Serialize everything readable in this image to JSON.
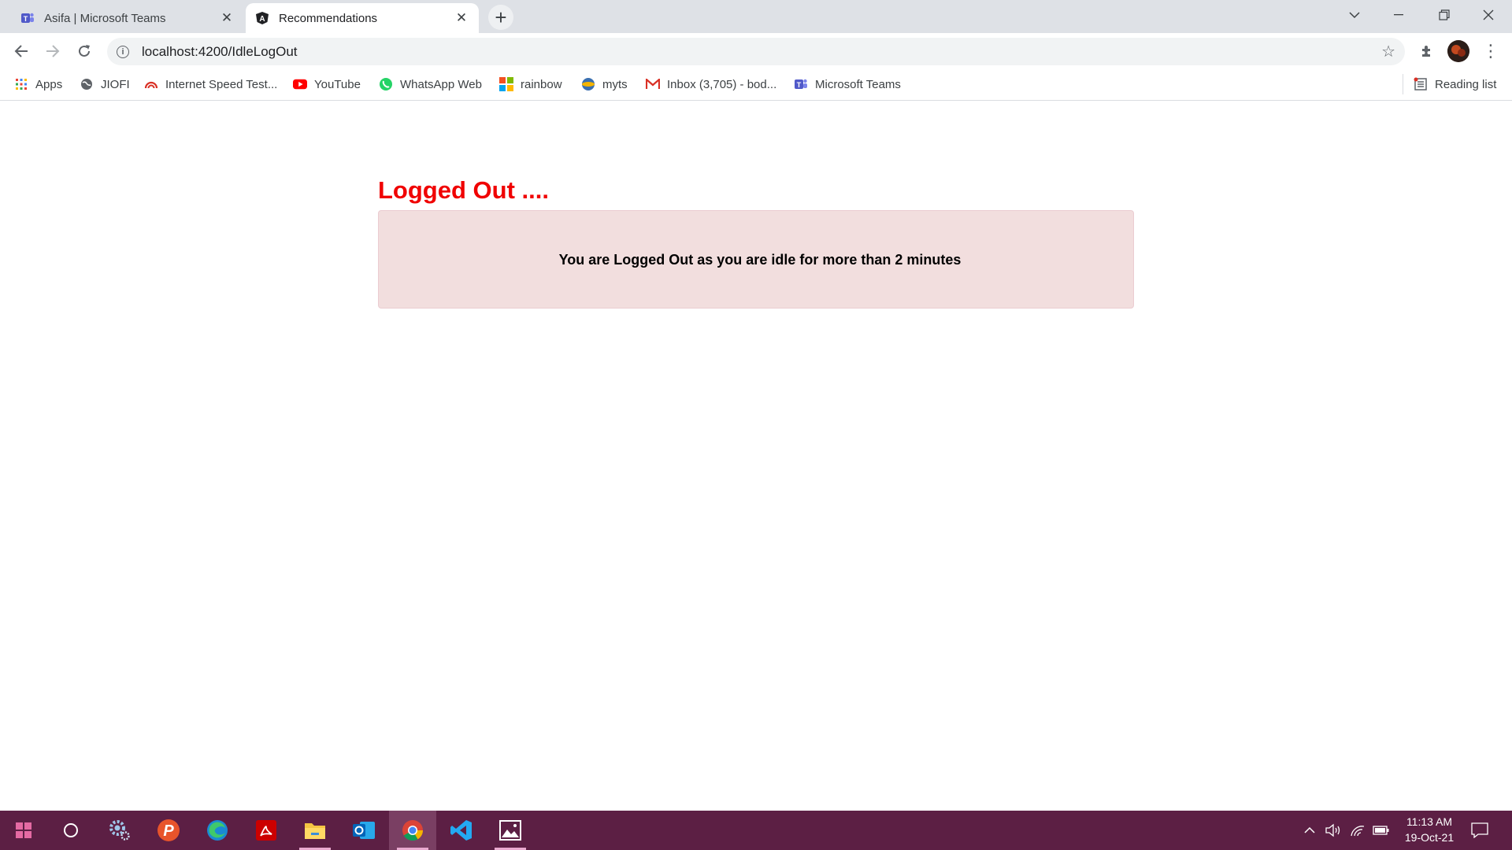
{
  "browser": {
    "tabs": [
      {
        "label": "Asifa | Microsoft Teams",
        "icon": "teams-icon",
        "active": false
      },
      {
        "label": "Recommendations",
        "icon": "angular-icon",
        "active": true
      }
    ],
    "address": "localhost:4200/IdleLogOut"
  },
  "bookmarks": [
    {
      "label": "Apps",
      "icon": "apps-grid-icon"
    },
    {
      "label": "JIOFI",
      "icon": "globe-icon"
    },
    {
      "label": "Internet Speed Test...",
      "icon": "speedtest-icon"
    },
    {
      "label": "YouTube",
      "icon": "youtube-icon"
    },
    {
      "label": "WhatsApp Web",
      "icon": "whatsapp-icon"
    },
    {
      "label": "rainbow",
      "icon": "microsoft-logo-icon"
    },
    {
      "label": "myts",
      "icon": "myts-icon"
    },
    {
      "label": "Inbox (3,705) - bod...",
      "icon": "gmail-icon"
    },
    {
      "label": "Microsoft Teams",
      "icon": "teams-icon"
    }
  ],
  "reading_list": "Reading list",
  "page": {
    "heading": "Logged Out ....",
    "message": "You are Logged Out as you are idle for more than 2 minutes"
  },
  "taskbar": {
    "time": "11:13 AM",
    "date": "19-Oct-21"
  },
  "colors": {
    "heading": "#f00000",
    "alert_bg": "#f2dede",
    "taskbar": "#5c1f44"
  }
}
